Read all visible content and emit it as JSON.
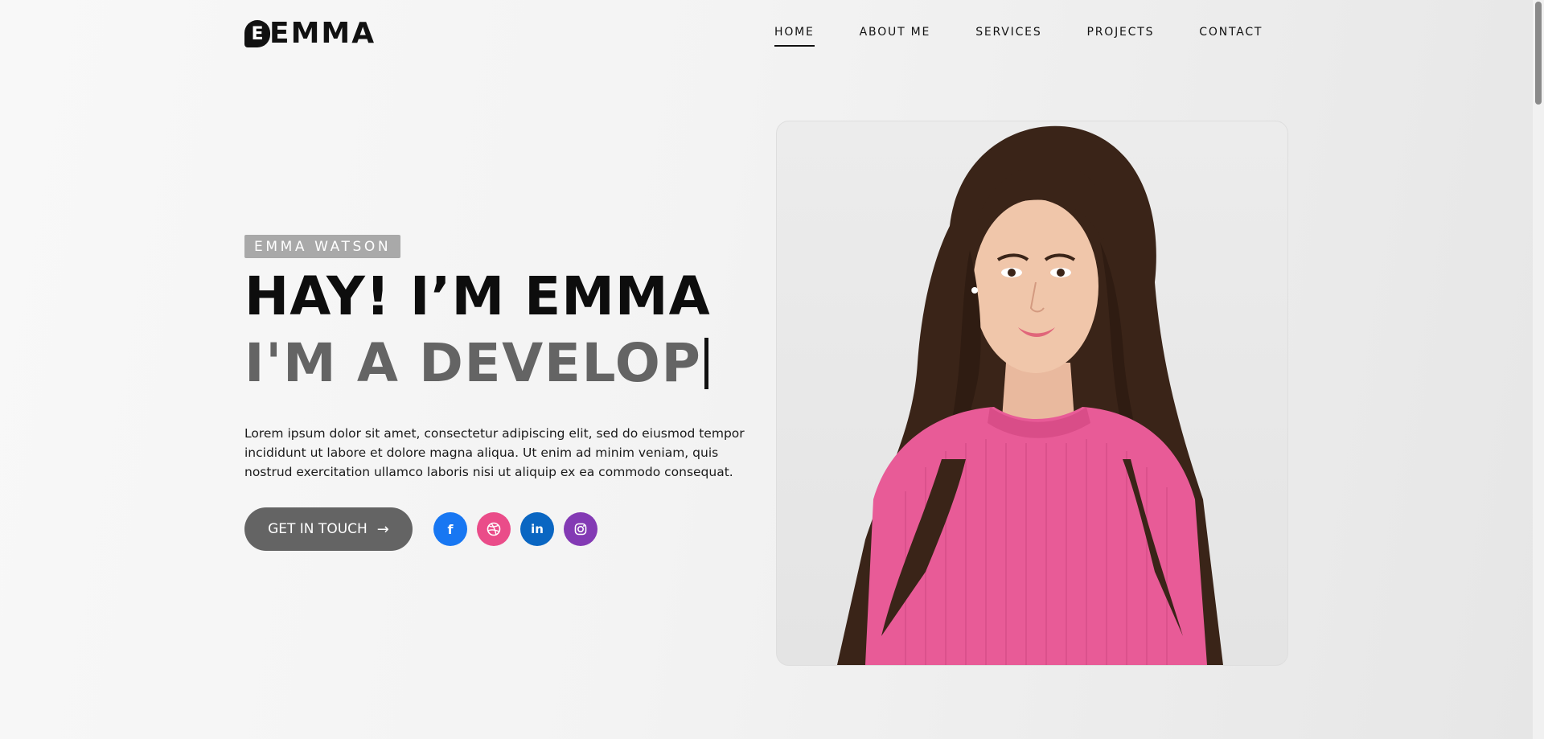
{
  "brand": {
    "logo_letter": "E",
    "logo_text": "EMMA"
  },
  "nav": {
    "items": [
      {
        "label": "HOME",
        "active": true
      },
      {
        "label": "ABOUT ME",
        "active": false
      },
      {
        "label": "SERVICES",
        "active": false
      },
      {
        "label": "PROJECTS",
        "active": false
      },
      {
        "label": "CONTACT",
        "active": false
      }
    ]
  },
  "hero": {
    "tag": "EMMA WATSON",
    "title": "HAY! I’M EMMA",
    "typing_text": "I'M A DEVELOP",
    "description": "Lorem ipsum dolor sit amet, consectetur adipiscing elit, sed do eiusmod tempor incididunt ut labore et dolore magna aliqua. Ut enim ad minim veniam, quis nostrud exercitation ullamco laboris nisi ut aliquip ex ea commodo consequat.",
    "cta_label": "GET IN TOUCH",
    "cta_icon": "arrow-right-icon"
  },
  "socials": [
    {
      "name": "facebook-icon",
      "glyph": "f",
      "color": "#1877f2"
    },
    {
      "name": "dribbble-icon",
      "glyph": "",
      "color": "#ea4c89"
    },
    {
      "name": "linkedin-icon",
      "glyph": "in",
      "color": "#0a66c2"
    },
    {
      "name": "instagram-icon",
      "glyph": "",
      "color": "#833ab4"
    }
  ],
  "colors": {
    "accent": "#646464",
    "tag_bg": "#a9a9a9",
    "sweater": "#e85b97",
    "hair": "#3a2418"
  }
}
